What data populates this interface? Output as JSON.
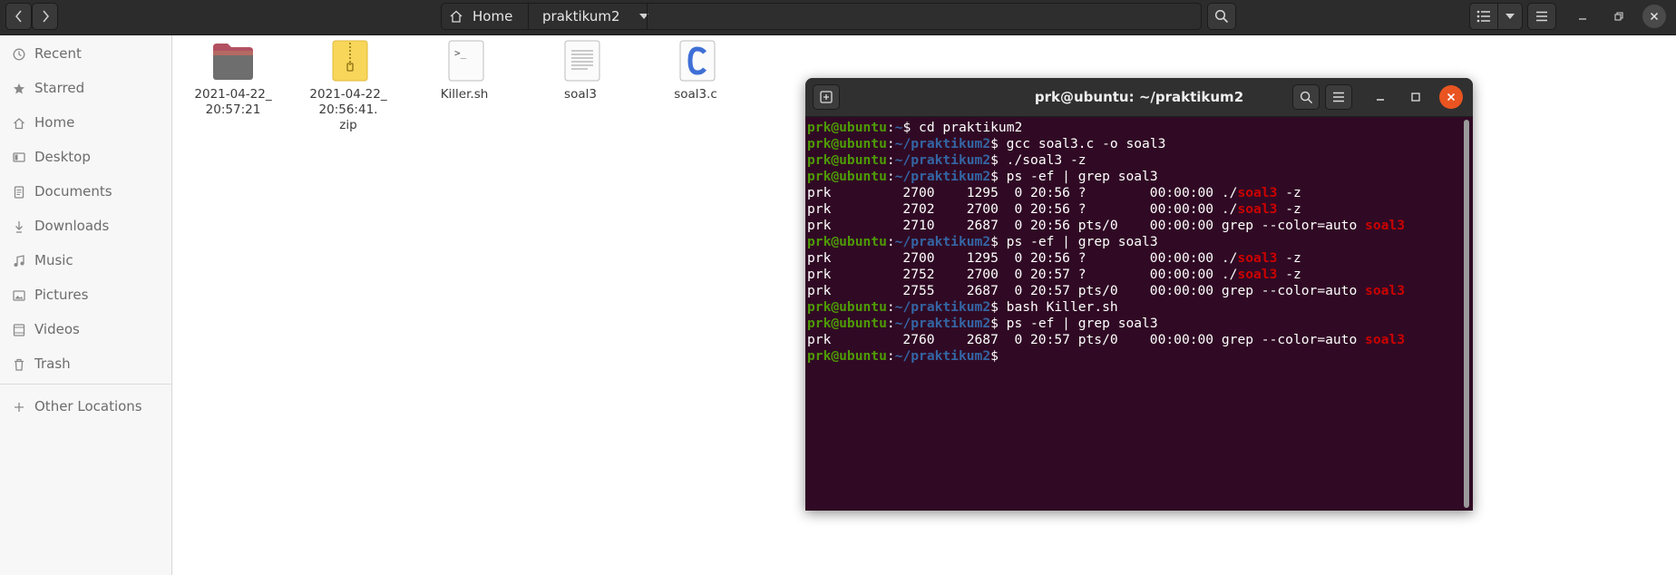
{
  "filemanager": {
    "breadcrumb": {
      "home": "Home",
      "current": "praktikum2"
    },
    "sidebar": [
      {
        "label": "Recent",
        "icon": "clock-icon"
      },
      {
        "label": "Starred",
        "icon": "star-icon"
      },
      {
        "label": "Home",
        "icon": "home-icon"
      },
      {
        "label": "Desktop",
        "icon": "desktop-icon"
      },
      {
        "label": "Documents",
        "icon": "document-icon"
      },
      {
        "label": "Downloads",
        "icon": "download-icon"
      },
      {
        "label": "Music",
        "icon": "music-icon"
      },
      {
        "label": "Pictures",
        "icon": "picture-icon"
      },
      {
        "label": "Videos",
        "icon": "video-icon"
      },
      {
        "label": "Trash",
        "icon": "trash-icon"
      },
      {
        "label": "Other Locations",
        "icon": "plus-icon"
      }
    ],
    "files": [
      {
        "name": "2021-04-22_\n20:57:21",
        "icon": "folder-icon"
      },
      {
        "name": "2021-04-22_\n20:56:41.\nzip",
        "icon": "zip-archive-icon"
      },
      {
        "name": "Killer.sh",
        "icon": "shell-script-icon"
      },
      {
        "name": "soal3",
        "icon": "text-file-icon"
      },
      {
        "name": "soal3.c",
        "icon": "c-source-icon"
      }
    ]
  },
  "terminal": {
    "title": "prk@ubuntu: ~/praktikum2",
    "prompt_user": "prk@ubuntu",
    "lines": [
      {
        "type": "prompt",
        "path": "~",
        "cmd": "cd praktikum2"
      },
      {
        "type": "prompt",
        "path": "~/praktikum2",
        "cmd": "gcc soal3.c -o soal3"
      },
      {
        "type": "prompt",
        "path": "~/praktikum2",
        "cmd": "./soal3 -z"
      },
      {
        "type": "prompt",
        "path": "~/praktikum2",
        "cmd": "ps -ef | grep soal3"
      },
      {
        "type": "out",
        "pre": "prk         2700    1295  0 20:56 ?        00:00:00 ./",
        "hl": "soal3",
        "post": " -z"
      },
      {
        "type": "out",
        "pre": "prk         2702    2700  0 20:56 ?        00:00:00 ./",
        "hl": "soal3",
        "post": " -z"
      },
      {
        "type": "out",
        "pre": "prk         2710    2687  0 20:56 pts/0    00:00:00 grep --color=auto ",
        "hl": "soal3",
        "post": ""
      },
      {
        "type": "prompt",
        "path": "~/praktikum2",
        "cmd": "ps -ef | grep soal3"
      },
      {
        "type": "out",
        "pre": "prk         2700    1295  0 20:56 ?        00:00:00 ./",
        "hl": "soal3",
        "post": " -z"
      },
      {
        "type": "out",
        "pre": "prk         2752    2700  0 20:57 ?        00:00:00 ./",
        "hl": "soal3",
        "post": " -z"
      },
      {
        "type": "out",
        "pre": "prk         2755    2687  0 20:57 pts/0    00:00:00 grep --color=auto ",
        "hl": "soal3",
        "post": ""
      },
      {
        "type": "prompt",
        "path": "~/praktikum2",
        "cmd": "bash Killer.sh"
      },
      {
        "type": "prompt",
        "path": "~/praktikum2",
        "cmd": "ps -ef | grep soal3"
      },
      {
        "type": "out",
        "pre": "prk         2760    2687  0 20:57 pts/0    00:00:00 grep --color=auto ",
        "hl": "soal3",
        "post": ""
      },
      {
        "type": "prompt",
        "path": "~/praktikum2",
        "cmd": ""
      }
    ]
  },
  "colors": {
    "terminal_bg": "#300a24",
    "prompt_user": "#4e9a06",
    "prompt_path": "#3465a4",
    "grep_highlight": "#cc0000",
    "close_button": "#e95420"
  }
}
